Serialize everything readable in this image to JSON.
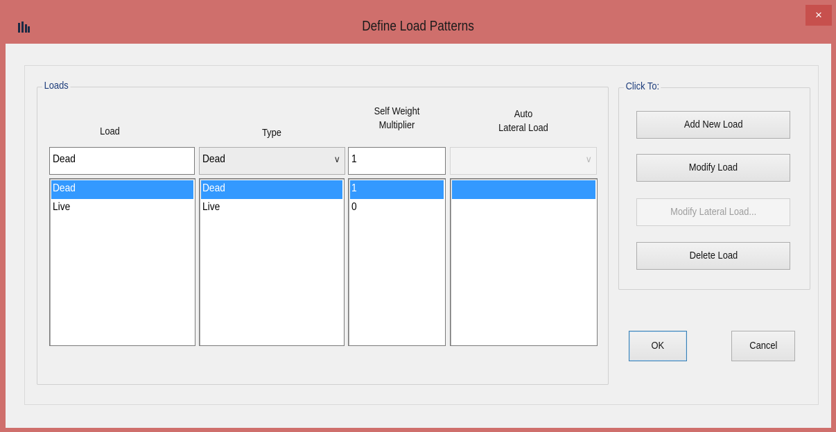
{
  "window": {
    "title": "Define Load Patterns",
    "close_glyph": "×",
    "app_icon": "etabs-app-icon",
    "colors": {
      "titlebar": "#cf6f6c",
      "close_button": "#c7504d",
      "selection": "#3399ff",
      "dialog_background": "#f0f0f0"
    }
  },
  "loads": {
    "legend": "Loads",
    "headers": {
      "load": "Load",
      "type": "Type",
      "self_weight_line1": "Self Weight",
      "self_weight_line2": "Multiplier",
      "auto_lateral_line1": "Auto",
      "auto_lateral_line2": "Lateral Load"
    },
    "inputs": {
      "load_value": "Dead",
      "type_value": "Dead",
      "self_weight_value": "1",
      "auto_lateral_value": ""
    },
    "rows": [
      {
        "load": "Dead",
        "type": "Dead",
        "self_weight": "1",
        "auto_lateral": "",
        "selected": true
      },
      {
        "load": "Live",
        "type": "Live",
        "self_weight": "0",
        "auto_lateral": "",
        "selected": false
      }
    ]
  },
  "click_to": {
    "legend": "Click To:",
    "add_new_load": "Add New Load",
    "modify_load": "Modify Load",
    "modify_lateral_load": "Modify Lateral Load...",
    "delete_load": "Delete Load"
  },
  "footer": {
    "ok": "OK",
    "cancel": "Cancel"
  }
}
